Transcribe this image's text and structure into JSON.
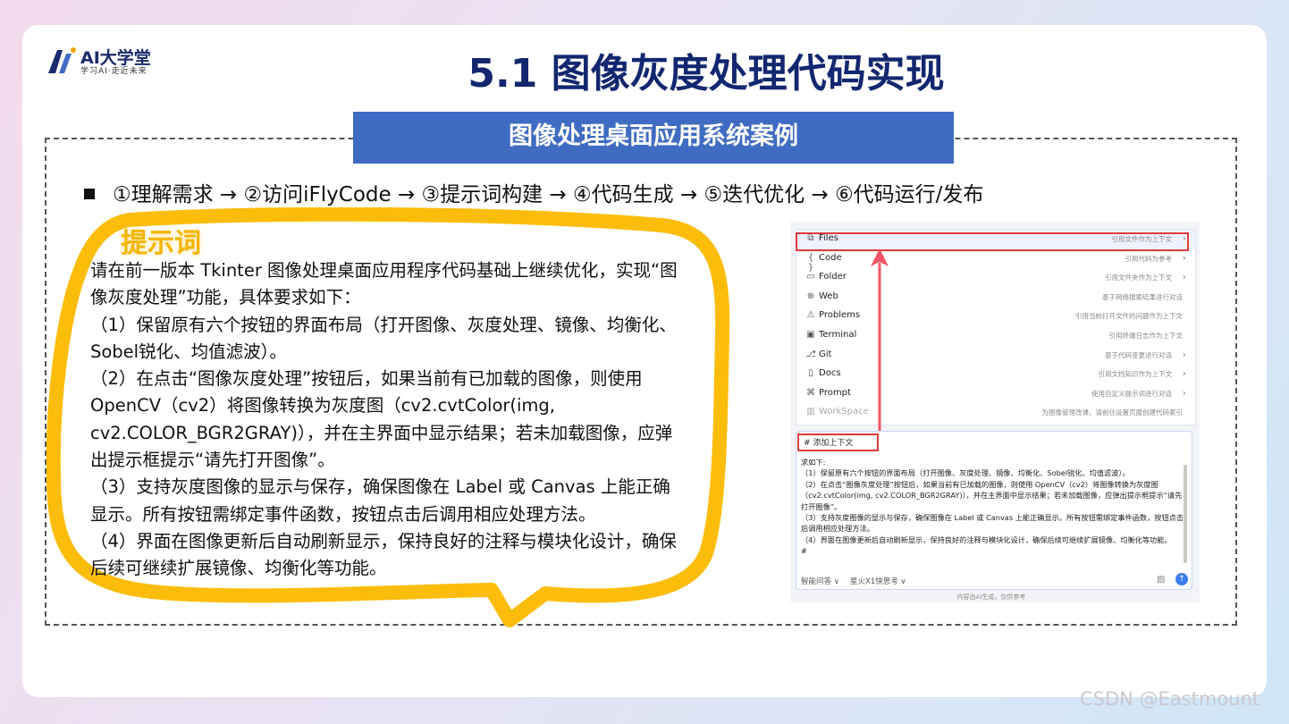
{
  "logo": {
    "name": "AI大学堂",
    "slogan": "学习AI·走近未来"
  },
  "slide": {
    "title": "5.1 图像灰度处理代码实现",
    "banner": "图像处理桌面应用系统案例",
    "steps": "①理解需求 → ②访问iFlyCode → ③提示词构建 → ④代码生成 → ⑤迭代优化 → ⑥代码运行/发布"
  },
  "prompt": {
    "label": "提示词",
    "paragraphs": [
      "请在前一版本 Tkinter 图像处理桌面应用程序代码基础上继续优化，实现“图像灰度处理”功能，具体要求如下：",
      "（1）保留原有六个按钮的界面布局（打开图像、灰度处理、镜像、均衡化、Sobel锐化、均值滤波）。",
      "（2）在点击“图像灰度处理”按钮后，如果当前有已加载的图像，则使用 OpenCV（cv2）将图像转换为灰度图（cv2.cvtColor(img, cv2.COLOR_BGR2GRAY)），并在主界面中显示结果；若未加载图像，应弹出提示框提示“请先打开图像”。",
      "（3）支持灰度图像的显示与保存，确保图像在 Label 或 Canvas 上能正确显示。所有按钮需绑定事件函数，按钮点击后调用相应处理方法。",
      "（4）界面在图像更新后自动刷新显示，保持良好的注释与模块化设计，确保后续可继续扩展镜像、均衡化等功能。"
    ]
  },
  "menu": {
    "items": [
      {
        "icon": "⧉",
        "label": "Files",
        "desc": "引用文件作为上下文"
      },
      {
        "icon": "{ }",
        "label": "Code",
        "desc": "引用代码为参考"
      },
      {
        "icon": "▭",
        "label": "Folder",
        "desc": "引用文件夹作为上下文"
      },
      {
        "icon": "⊕",
        "label": "Web",
        "desc": "基于网络搜索结果进行对话"
      },
      {
        "icon": "⚠",
        "label": "Problems",
        "desc": "引用当前打开文件的问题作为上下文"
      },
      {
        "icon": "▣",
        "label": "Terminal",
        "desc": "引用终端日志作为上下文"
      },
      {
        "icon": "⎇",
        "label": "Git",
        "desc": "基于代码变更进行对话"
      },
      {
        "icon": "▯",
        "label": "Docs",
        "desc": "引用文档知识作为上下文"
      },
      {
        "icon": "⌘",
        "label": "Prompt",
        "desc": "使用自定义提示词进行对话"
      },
      {
        "icon": "▥",
        "label": "WorkSpace",
        "desc": "为图像管理改课，请前往设置页面创建代码索引"
      }
    ]
  },
  "chat": {
    "add_context": "# 添加上下文",
    "lines": [
      "求如下:",
      "（1）保留原有六个按钮的界面布局（打开图像、灰度处理、镜像、均衡化、Sobel锐化、均值滤波）。",
      "（2）在点击“图像灰度处理”按钮后，如果当前有已加载的图像，则使用 OpenCV（cv2）将图像转换为灰度图（cv2.cvtColor(img, cv2.COLOR_BGR2GRAY)），并在主界面中显示结果；若未加载图像，应弹出提示框提示“请先打开图像”。",
      "（3）支持灰度图像的显示与保存，确保图像在 Label 或 Canvas 上能正确显示。所有按钮需绑定事件函数，按钮点击后调用相应处理方法。",
      "（4）界面在图像更新后自动刷新显示，保持良好的注释与模块化设计，确保后续可继续扩展镜像、均衡化等功能。",
      "#"
    ],
    "mode": "智能问答 ∨",
    "model": "星火X1快思考 ∨",
    "disclaimer": "内容由AI生成，仅供参考"
  },
  "watermark": "CSDN @Eastmount",
  "colors": {
    "title": "#12276f",
    "banner": "#3f6cc2",
    "bubble": "#fbbd0a",
    "highlight": "#e23b3b"
  }
}
